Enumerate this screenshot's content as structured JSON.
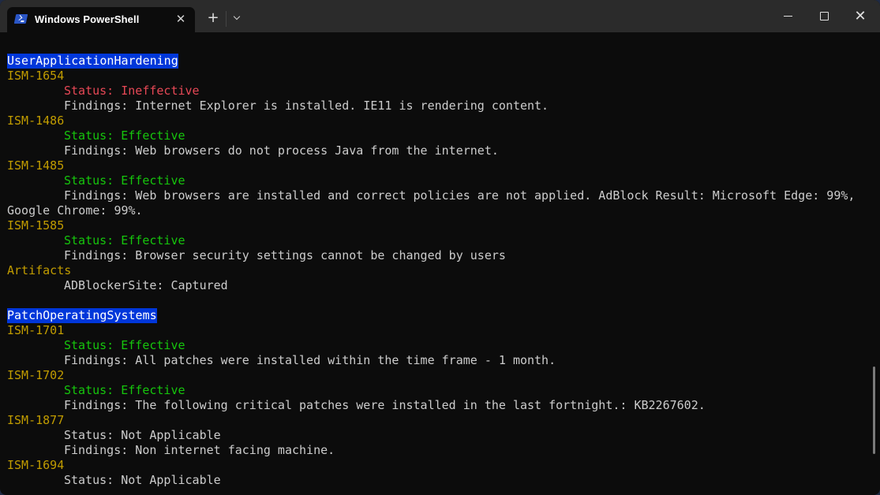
{
  "window": {
    "tab_title": "Windows PowerShell",
    "tab_icon": "powershell-icon",
    "close_tab_glyph": "✕",
    "new_tab_glyph": "+",
    "close_window_glyph": "✕"
  },
  "colors": {
    "background": "#0c0c0c",
    "heading_highlight": "#0037da",
    "id_yellow": "#c19c00",
    "status_ineffective": "#e74856",
    "status_effective": "#16c60c",
    "text": "#cccccc"
  },
  "sections": [
    {
      "heading": "UserApplicationHardening",
      "items": [
        {
          "id": "ISM-1654",
          "status": "Status: Ineffective",
          "findings": "Findings: Internet Explorer is installed. IE11 is rendering content."
        },
        {
          "id": "ISM-1486",
          "status": "Status: Effective",
          "findings": "Findings: Web browsers do not process Java from the internet."
        },
        {
          "id": "ISM-1485",
          "status": "Status: Effective",
          "findings": "Findings: Web browsers are installed and correct policies are not applied. AdBlock Result: Microsoft Edge: 99%,",
          "findings_wrap": "Google Chrome: 99%."
        },
        {
          "id": "ISM-1585",
          "status": "Status: Effective",
          "findings": "Findings: Browser security settings cannot be changed by users"
        }
      ],
      "artifacts_label": "Artifacts",
      "artifacts": [
        "ADBlockerSite: Captured"
      ]
    },
    {
      "heading": "PatchOperatingSystems",
      "items": [
        {
          "id": "ISM-1701",
          "status": "Status: Effective",
          "findings": "Findings: All patches were installed within the time frame - 1 month."
        },
        {
          "id": "ISM-1702",
          "status": "Status: Effective",
          "findings": "Findings: The following critical patches were installed in the last fortnight.: KB2267602."
        },
        {
          "id": "ISM-1877",
          "status": "Status: Not Applicable",
          "findings": "Findings: Non internet facing machine."
        },
        {
          "id": "ISM-1694",
          "status": "Status: Not Applicable"
        }
      ]
    }
  ]
}
